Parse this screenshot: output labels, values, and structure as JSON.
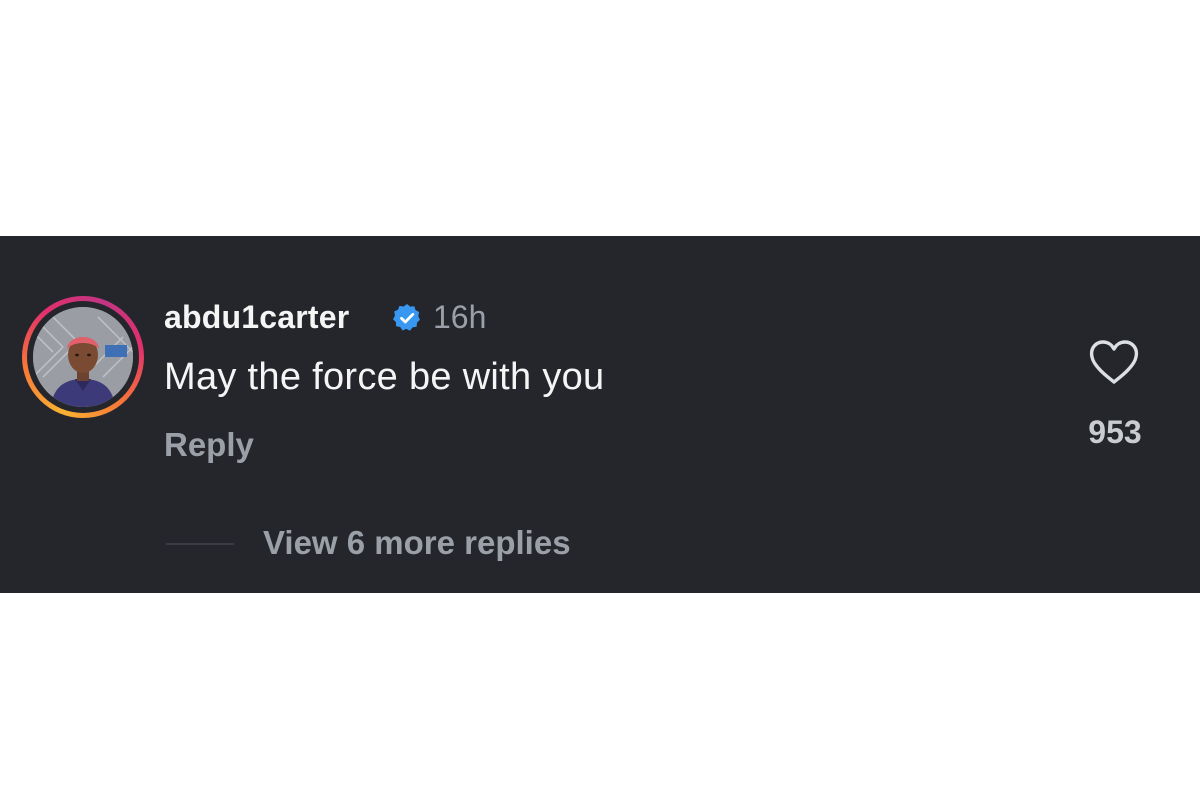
{
  "comment": {
    "username": "abdu1carter",
    "verified": true,
    "timestamp": "16h",
    "text": "May the force be with you",
    "reply_label": "Reply",
    "like_count": "953",
    "view_replies_label": "View 6 more replies"
  },
  "icons": {
    "verified": "verified-badge-icon",
    "like": "heart-outline-icon"
  },
  "colors": {
    "panel_background": "#24262c",
    "primary_text": "#f5f5f5",
    "secondary_text": "#9ba0a8",
    "verified_blue": "#3897f0",
    "story_ring_gradient": [
      "#f9b233",
      "#f77737",
      "#e1306c",
      "#c13584"
    ]
  }
}
